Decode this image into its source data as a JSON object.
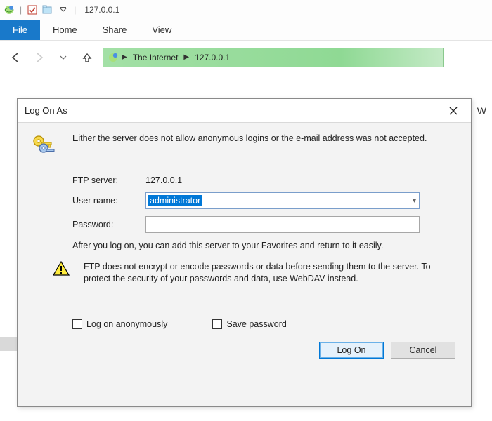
{
  "window": {
    "title": "127.0.0.1"
  },
  "ribbon": {
    "file": "File",
    "home": "Home",
    "share": "Share",
    "view": "View"
  },
  "breadcrumb": {
    "root": "The Internet",
    "current": "127.0.0.1"
  },
  "side_letter": "W",
  "dialog": {
    "title": "Log On As",
    "message": "Either the server does not allow anonymous logins or the e-mail address was not accepted.",
    "server_label": "FTP server:",
    "server_value": "127.0.0.1",
    "user_label": "User name:",
    "user_value": "administrator",
    "password_label": "Password:",
    "password_value": "",
    "after_text": "After you log on, you can add this server to your Favorites and return to it easily.",
    "warn_text": "FTP does not encrypt or encode passwords or data before sending them to the server.  To protect the security of your passwords and data, use WebDAV instead.",
    "anon_label": "Log on anonymously",
    "save_label": "Save password",
    "logon_btn": "Log On",
    "cancel_btn": "Cancel"
  }
}
